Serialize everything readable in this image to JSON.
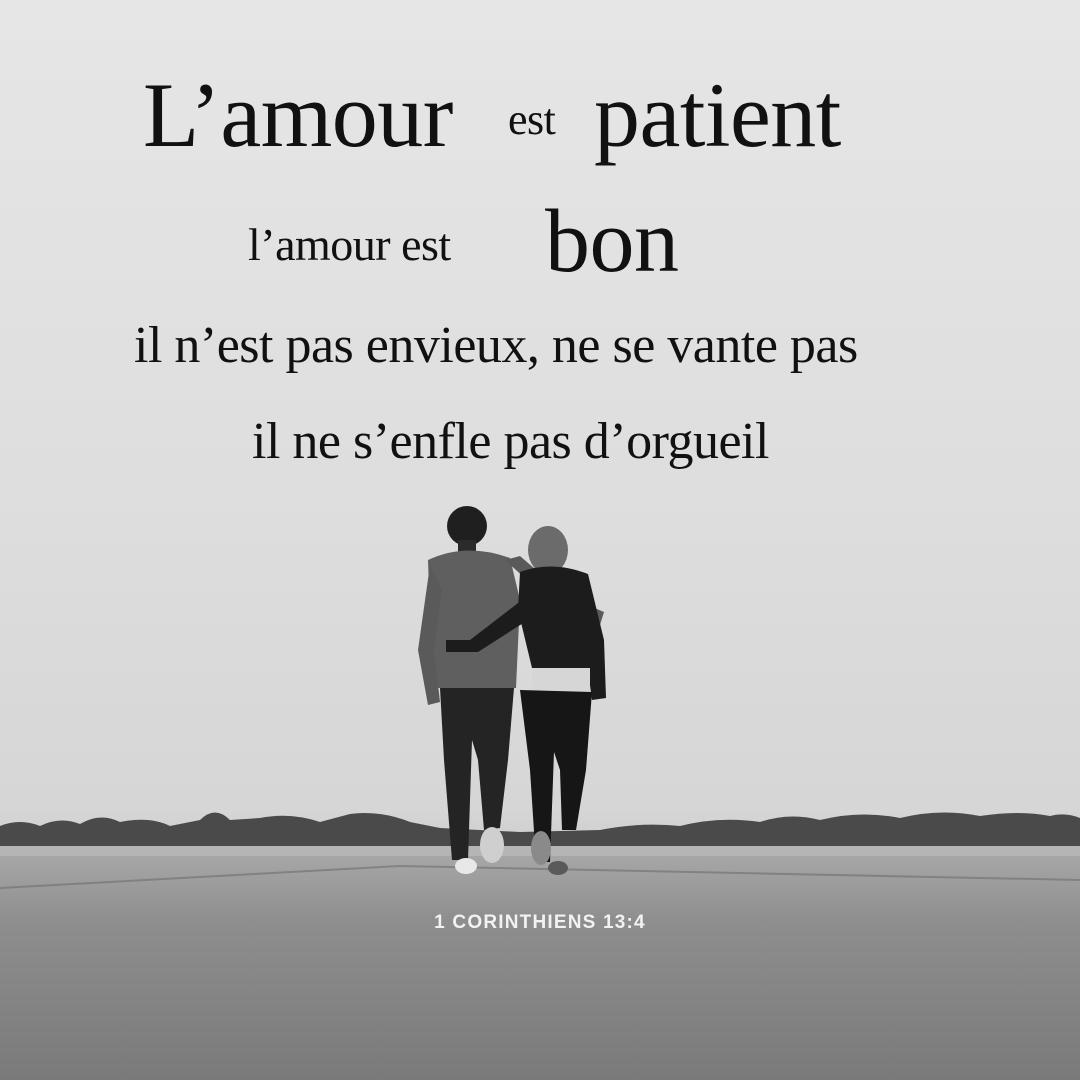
{
  "quote": {
    "line1": {
      "word1": "L’amour",
      "word2": "est",
      "word3": "patient"
    },
    "line2": {
      "word1": "l’amour est",
      "word2": "bon"
    },
    "line3": "il n’est pas envieux, ne se vante pas",
    "line4": "il ne s’enfle pas d’orgueil"
  },
  "reference": "1 CORINTHIENS 13:4",
  "colors": {
    "text": "#111111",
    "reference": "#f2f2f2"
  }
}
